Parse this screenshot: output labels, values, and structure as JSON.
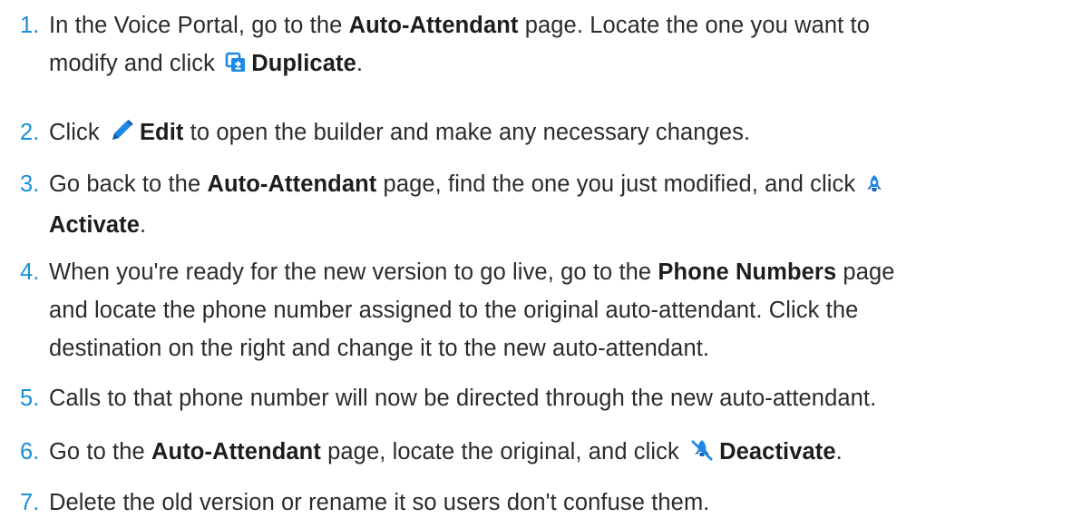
{
  "steps": [
    {
      "number": "1.",
      "parts": {
        "a": "In the Voice Portal, go to the ",
        "b": "Auto-Attendant",
        "c": " page. Locate the one you want to",
        "d": "modify and click ",
        "icon": "duplicate-icon",
        "e": "Duplicate",
        "f": "."
      }
    },
    {
      "number": "2.",
      "parts": {
        "a": "Click ",
        "icon": "pencil-icon",
        "b": "Edit",
        "c": " to open the builder and make any necessary changes."
      }
    },
    {
      "number": "3.",
      "parts": {
        "a": "Go back to the ",
        "b": "Auto-Attendant",
        "c": " page, find the one you just modified, and click ",
        "icon": "rocket-icon",
        "d": "Activate",
        "e": "."
      }
    },
    {
      "number": "4.",
      "parts": {
        "a": "When you're ready for the new version to go live, go to the ",
        "b": "Phone Numbers",
        "c": " page",
        "line2": "and locate the phone number assigned to the original auto-attendant. Click the",
        "line3": "destination on the right and change it to the new auto-attendant."
      }
    },
    {
      "number": "5.",
      "parts": {
        "a": "Calls to that phone number will now be directed through the new auto-attendant."
      }
    },
    {
      "number": "6.",
      "parts": {
        "a": "Go to the ",
        "b": "Auto-Attendant",
        "c": " page, locate the original, and click ",
        "icon": "deactivate-icon",
        "d": "Deactivate",
        "e": "."
      }
    },
    {
      "number": "7.",
      "parts": {
        "a": "Delete the old version or rename it so users don't confuse them."
      }
    }
  ],
  "colors": {
    "number": "#1a8fd8",
    "icon": "#1e88e5",
    "text": "#2b2b2b"
  }
}
